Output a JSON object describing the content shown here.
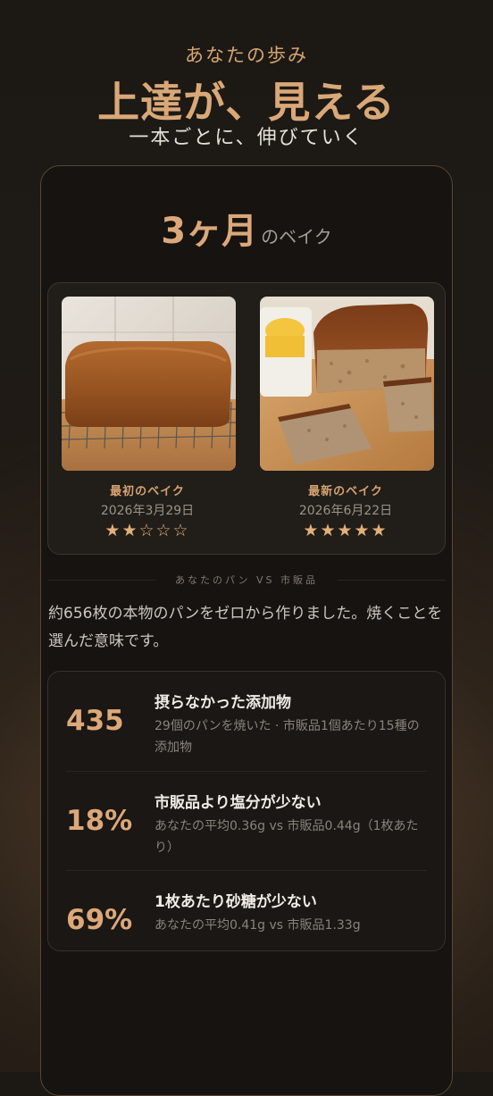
{
  "hero": {
    "eyebrow": "あなたの歩み",
    "headline": "上達が、見える",
    "subhead": "一本ごとに、伸びていく"
  },
  "progress_card": {
    "period_number": "3ヶ月",
    "period_suffix": "のベイク",
    "first_bake": {
      "label": "最初のベイク",
      "date": "2026年3月29日",
      "stars": "★★☆☆☆",
      "rating": 2,
      "rating_max": 5
    },
    "latest_bake": {
      "label": "最新のベイク",
      "date": "2026年6月22日",
      "stars": "★★★★★",
      "rating": 5,
      "rating_max": 5
    },
    "divider_text": "あなたのパン VS 市販品",
    "intro": "約656枚の本物のパンをゼロから作りました。焼くことを選んだ意味です。",
    "stats": [
      {
        "value": "435",
        "title": "摂らなかった添加物",
        "description": "29個のパンを焼いた · 市販品1個あたり15種の添加物"
      },
      {
        "value": "18%",
        "title": "市販品より塩分が少ない",
        "description": "あなたの平均0.36g vs 市販品0.44g（1枚あたり）"
      },
      {
        "value": "69%",
        "title": "1枚あたり砂糖が少ない",
        "description": "あなたの平均0.41g vs 市販品1.33g"
      }
    ]
  },
  "colors": {
    "accent": "#dca879",
    "background": "#1c1915",
    "card": "#161310"
  }
}
